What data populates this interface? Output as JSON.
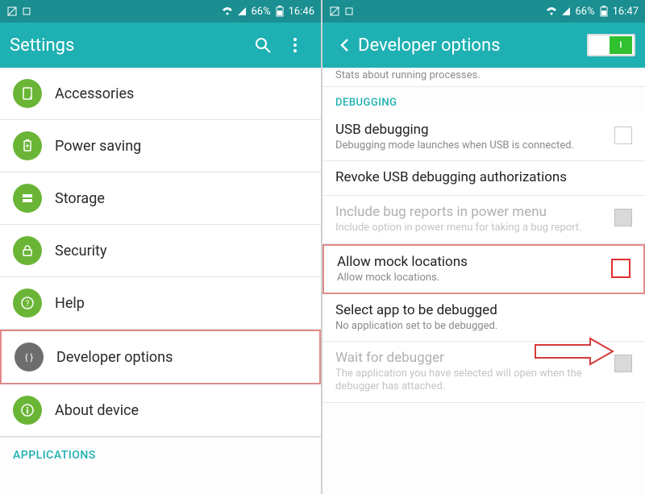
{
  "left": {
    "status": {
      "battery": "66%",
      "time": "16:46"
    },
    "appbar_title": "Settings",
    "items": [
      {
        "label": "Accessories"
      },
      {
        "label": "Power saving"
      },
      {
        "label": "Storage"
      },
      {
        "label": "Security"
      },
      {
        "label": "Help"
      },
      {
        "label": "Developer options"
      },
      {
        "label": "About device"
      }
    ],
    "section_applications": "APPLICATIONS"
  },
  "right": {
    "status": {
      "battery": "66%",
      "time": "16:47"
    },
    "appbar_title": "Developer options",
    "partial_sub": "Stats about running processes.",
    "section_debugging": "DEBUGGING",
    "opts": {
      "usb": {
        "title": "USB debugging",
        "sub": "Debugging mode launches when USB is connected."
      },
      "revoke": {
        "title": "Revoke USB debugging authorizations"
      },
      "bugreport": {
        "title": "Include bug reports in power menu",
        "sub": "Include option in power menu for taking a bug report."
      },
      "mock": {
        "title": "Allow mock locations",
        "sub": "Allow mock locations."
      },
      "selectapp": {
        "title": "Select app to be debugged",
        "sub": "No application set to be debugged."
      },
      "waitdbg": {
        "title": "Wait for debugger",
        "sub": "The application you have selected will open when the debugger has attached."
      }
    }
  }
}
